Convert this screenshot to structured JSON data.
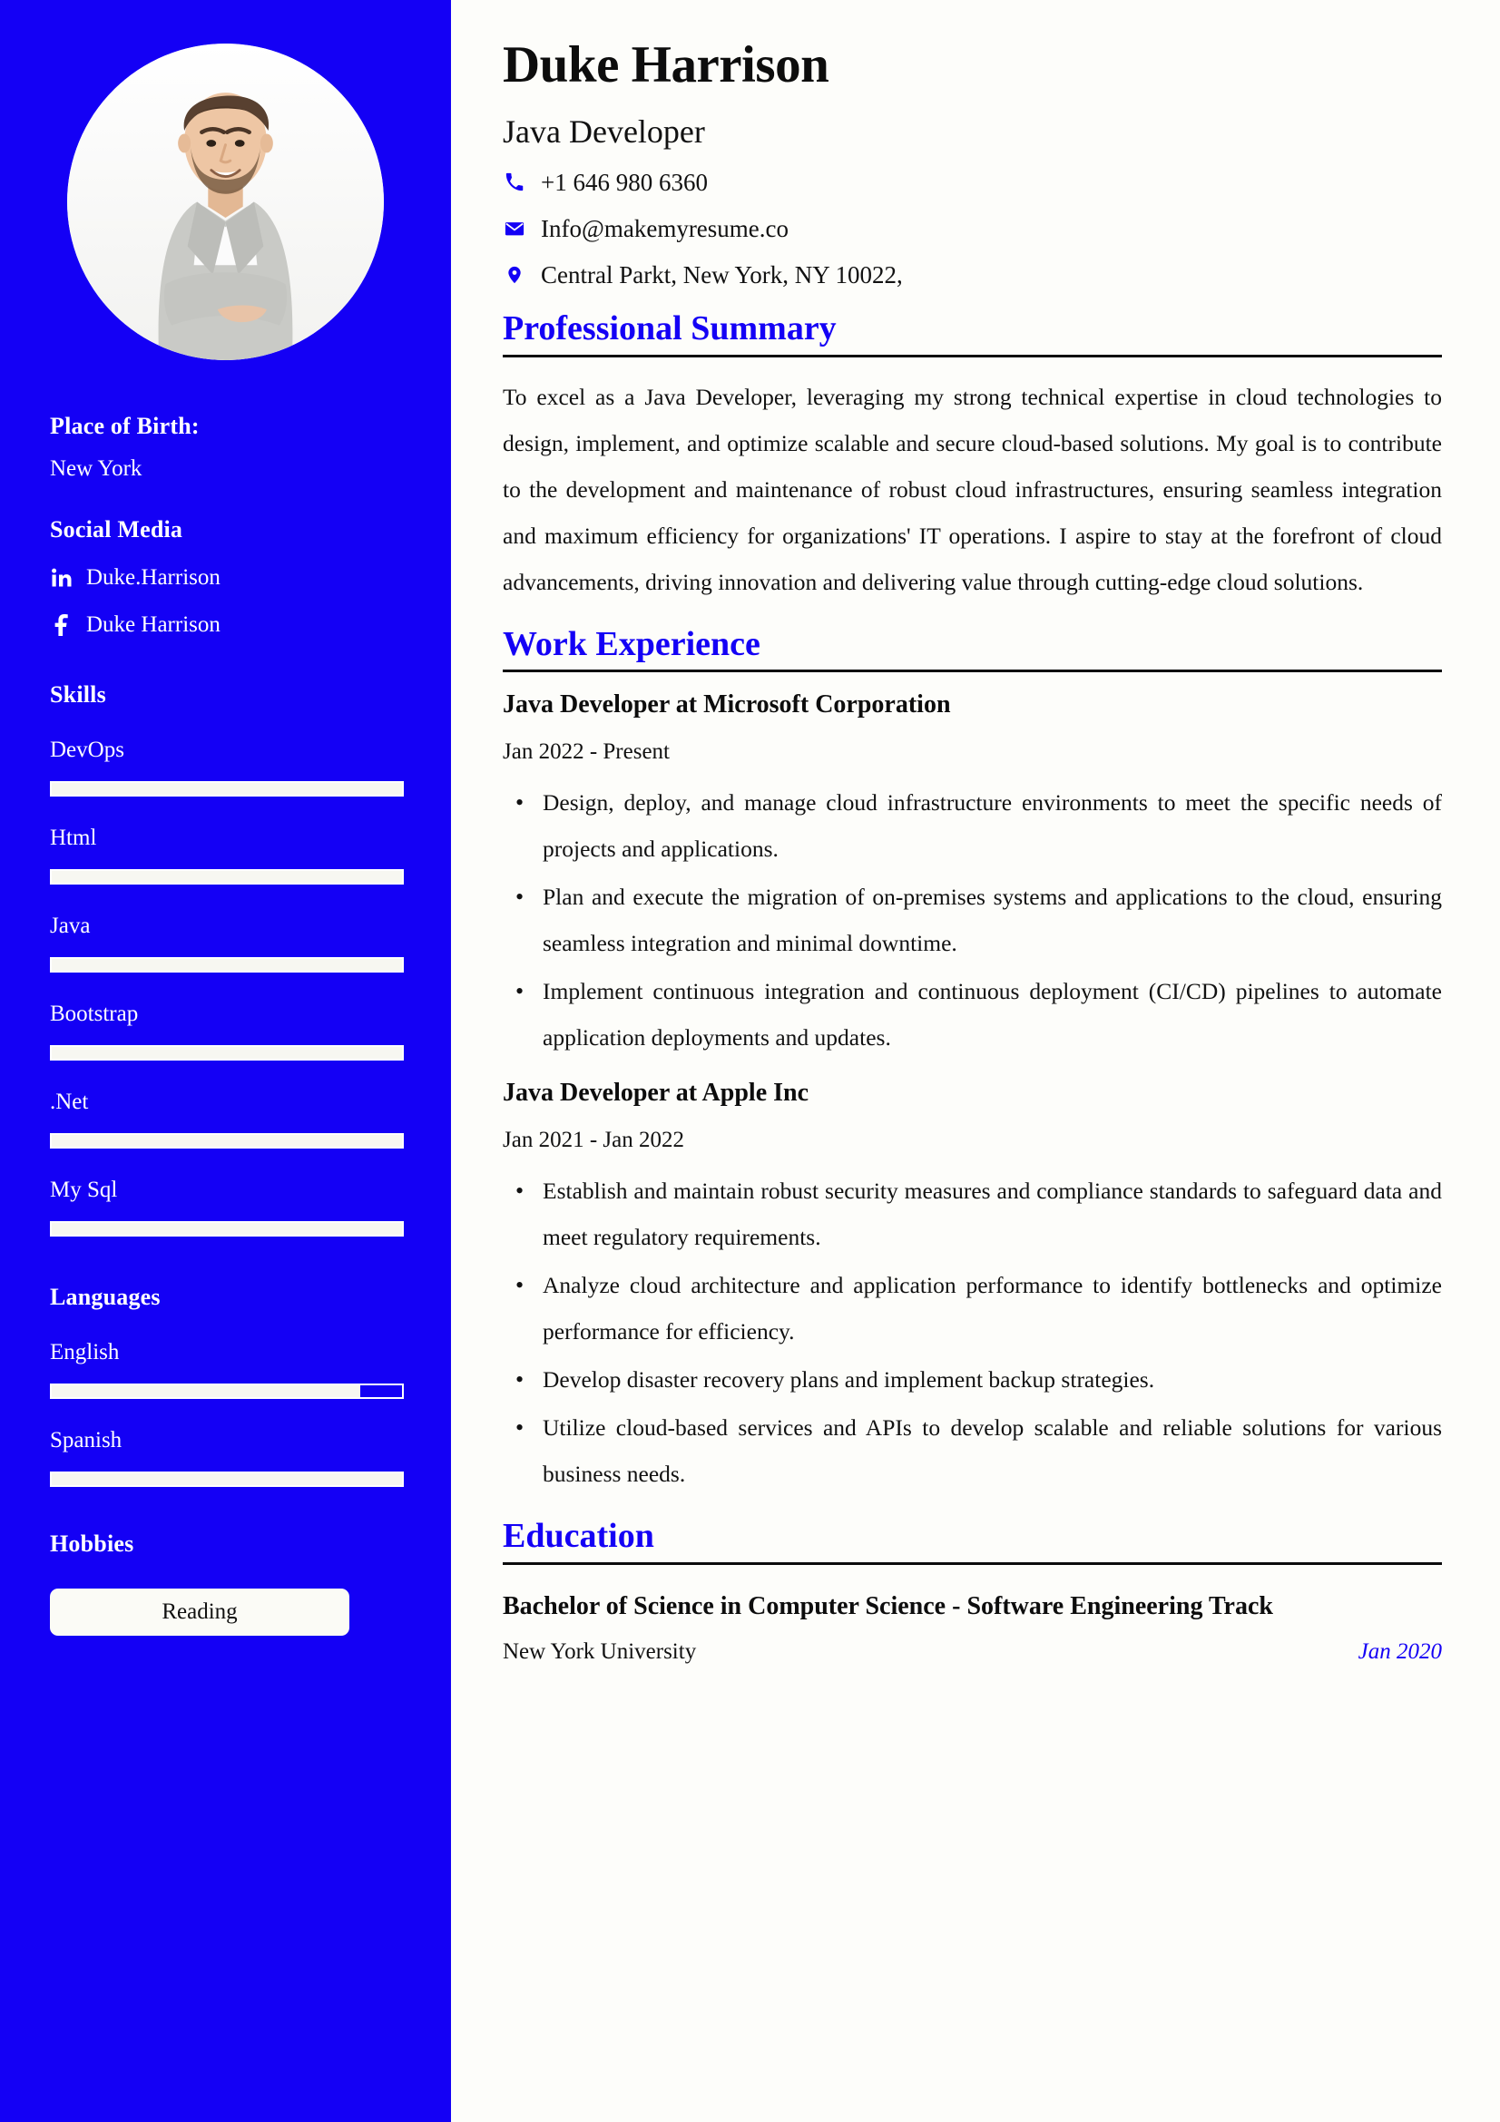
{
  "colors": {
    "sidebar_bg": "#1400f5",
    "accent": "#1400f5",
    "page_bg": "#fdfdfa",
    "text": "#111111",
    "rule": "#0c0c0c"
  },
  "header": {
    "name": "Duke Harrison",
    "role": "Java Developer",
    "contacts": [
      {
        "icon": "phone-icon",
        "value": "+1 646 980 6360"
      },
      {
        "icon": "envelope-icon",
        "value": "Info@makemyresume.co"
      },
      {
        "icon": "map-pin-icon",
        "value": "Central Parkt, New York, NY 10022,"
      }
    ]
  },
  "sidebar": {
    "place_of_birth": {
      "heading": "Place of Birth:",
      "value": "New York"
    },
    "social_media": {
      "heading": "Social Media",
      "items": [
        {
          "icon": "linkedin-icon",
          "label": "Duke.Harrison"
        },
        {
          "icon": "facebook-icon",
          "label": "Duke Harrison"
        }
      ]
    },
    "skills": {
      "heading": "Skills",
      "items": [
        {
          "name": "DevOps",
          "level": 100
        },
        {
          "name": "Html",
          "level": 100
        },
        {
          "name": "Java",
          "level": 100
        },
        {
          "name": "Bootstrap",
          "level": 100
        },
        {
          "name": ".Net",
          "level": 100
        },
        {
          "name": "My Sql",
          "level": 100
        }
      ]
    },
    "languages": {
      "heading": "Languages",
      "items": [
        {
          "name": "English",
          "level": 88
        },
        {
          "name": "Spanish",
          "level": 100
        }
      ]
    },
    "hobbies": {
      "heading": "Hobbies",
      "items": [
        "Reading"
      ]
    }
  },
  "main": {
    "summary": {
      "title": "Professional Summary",
      "text": "To excel as a Java Developer, leveraging my strong technical expertise in cloud technologies to design, implement, and optimize scalable and secure cloud-based solutions. My goal is to contribute to the development and maintenance of robust cloud infrastructures, ensuring seamless integration and maximum efficiency for organizations' IT operations. I aspire to stay at the forefront of cloud advancements, driving innovation and delivering value through cutting-edge cloud solutions."
    },
    "work_experience": {
      "title": "Work Experience",
      "jobs": [
        {
          "title": "Java Developer at Microsoft Corporation",
          "dates": "Jan 2022 - Present",
          "bullets": [
            "Design, deploy, and manage cloud infrastructure environments to meet the specific needs of projects and applications.",
            "Plan and execute the migration of on-premises systems and applications to the cloud, ensuring seamless integration and minimal downtime.",
            "Implement continuous integration and continuous deployment (CI/CD) pipelines to automate application deployments and updates."
          ]
        },
        {
          "title": "Java Developer at Apple Inc",
          "dates": "Jan 2021 - Jan 2022",
          "bullets": [
            "Establish and maintain robust security measures and compliance standards to safeguard data and meet regulatory requirements.",
            "Analyze cloud architecture and application performance to identify bottlenecks and optimize performance for efficiency.",
            "Develop disaster recovery plans and implement backup strategies.",
            "Utilize cloud-based services and APIs to develop scalable and reliable solutions for various business needs."
          ]
        }
      ]
    },
    "education": {
      "title": "Education",
      "entries": [
        {
          "degree": "Bachelor of Science in Computer Science - Software Engineering Track",
          "school": "New York University",
          "date": "Jan 2020"
        }
      ]
    }
  }
}
